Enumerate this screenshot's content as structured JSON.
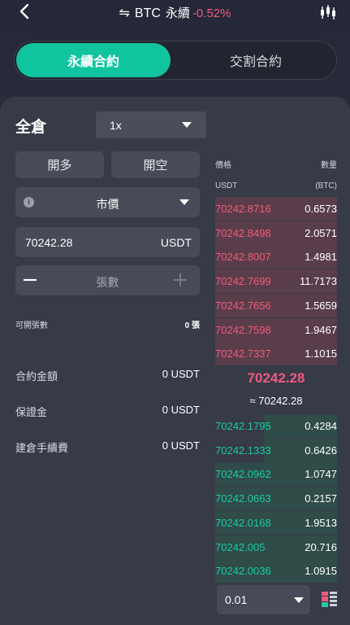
{
  "header": {
    "swap_symbol": "⇋",
    "symbol": "BTC",
    "contract_type": "永續",
    "change": "-0.52%",
    "change_color": "#ef5b7d"
  },
  "tabs": [
    {
      "label": "永續合約",
      "active": true
    },
    {
      "label": "交割合約",
      "active": false
    }
  ],
  "form": {
    "margin_mode": "全倉",
    "leverage": "1x",
    "open_long_label": "開多",
    "open_short_label": "開空",
    "order_type": "市價",
    "price_value": "70242.28",
    "price_unit": "USDT",
    "qty_placeholder": "張數",
    "available_label": "可開張數",
    "available_value": "0 張"
  },
  "summary": [
    {
      "label": "合約金額",
      "value": "0 USDT"
    },
    {
      "label": "保證金",
      "value": "0 USDT"
    },
    {
      "label": "建倉手續費",
      "value": "0 USDT"
    }
  ],
  "orderbook": {
    "price_header": "價格",
    "qty_header": "數量",
    "price_unit": "USDT",
    "qty_unit": "(BTC)",
    "asks": [
      {
        "price": "70242.8716",
        "qty": "0.6573",
        "depth": 1.0
      },
      {
        "price": "70242.8498",
        "qty": "2.0571",
        "depth": 1.0
      },
      {
        "price": "70242.8007",
        "qty": "1.4981",
        "depth": 1.0
      },
      {
        "price": "70242.7699",
        "qty": "11.7173",
        "depth": 1.0
      },
      {
        "price": "70242.7656",
        "qty": "1.5659",
        "depth": 1.0
      },
      {
        "price": "70242.7598",
        "qty": "1.9467",
        "depth": 1.0
      },
      {
        "price": "70242.7337",
        "qty": "1.1015",
        "depth": 1.0
      }
    ],
    "last_price": "70242.28",
    "index_price": "≈ 70242.28",
    "bids": [
      {
        "price": "70242.1795",
        "qty": "0.4284",
        "depth": 0.6
      },
      {
        "price": "70242.1333",
        "qty": "0.6426",
        "depth": 0.6
      },
      {
        "price": "70242.0962",
        "qty": "1.0747",
        "depth": 1.0
      },
      {
        "price": "70242.0663",
        "qty": "0.2157",
        "depth": 1.0
      },
      {
        "price": "70242.0168",
        "qty": "1.9513",
        "depth": 1.0
      },
      {
        "price": "70242.005",
        "qty": "20.716",
        "depth": 1.0
      },
      {
        "price": "70242.0036",
        "qty": "1.0915",
        "depth": 1.0
      }
    ],
    "depth_step": "0.01"
  },
  "colors": {
    "accent": "#10c4a0",
    "ask": "#ef5b7d",
    "bid": "#1ccaa2"
  },
  "icons": {
    "back": "chevron-left-icon",
    "kline": "candlestick-icon",
    "info": "info-icon",
    "minus": "minus-icon",
    "plus": "plus-icon",
    "layout": "orderbook-layout-icon"
  }
}
